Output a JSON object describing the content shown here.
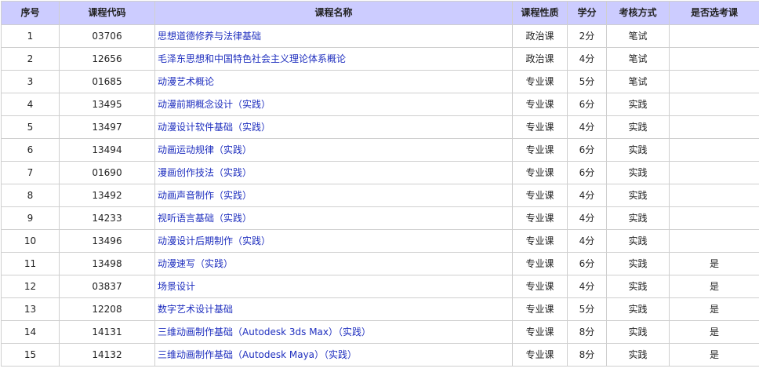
{
  "table": {
    "headers": [
      "序号",
      "课程代码",
      "课程名称",
      "课程性质",
      "学分",
      "考核方式",
      "是否选考课"
    ],
    "rows": [
      {
        "index": "1",
        "code": "03706",
        "name": "思想道德修养与法律基础",
        "type": "政治课",
        "credit": "2分",
        "exam": "笔试",
        "elective": ""
      },
      {
        "index": "2",
        "code": "12656",
        "name": "毛泽东思想和中国特色社会主义理论体系概论",
        "type": "政治课",
        "credit": "4分",
        "exam": "笔试",
        "elective": ""
      },
      {
        "index": "3",
        "code": "01685",
        "name": "动漫艺术概论",
        "type": "专业课",
        "credit": "5分",
        "exam": "笔试",
        "elective": ""
      },
      {
        "index": "4",
        "code": "13495",
        "name": "动漫前期概念设计（实践）",
        "type": "专业课",
        "credit": "6分",
        "exam": "实践",
        "elective": ""
      },
      {
        "index": "5",
        "code": "13497",
        "name": "动漫设计软件基础（实践）",
        "type": "专业课",
        "credit": "4分",
        "exam": "实践",
        "elective": ""
      },
      {
        "index": "6",
        "code": "13494",
        "name": "动画运动规律（实践）",
        "type": "专业课",
        "credit": "6分",
        "exam": "实践",
        "elective": ""
      },
      {
        "index": "7",
        "code": "01690",
        "name": "漫画创作技法（实践）",
        "type": "专业课",
        "credit": "6分",
        "exam": "实践",
        "elective": ""
      },
      {
        "index": "8",
        "code": "13492",
        "name": "动画声音制作（实践）",
        "type": "专业课",
        "credit": "4分",
        "exam": "实践",
        "elective": ""
      },
      {
        "index": "9",
        "code": "14233",
        "name": "视听语言基础（实践）",
        "type": "专业课",
        "credit": "4分",
        "exam": "实践",
        "elective": ""
      },
      {
        "index": "10",
        "code": "13496",
        "name": "动漫设计后期制作（实践）",
        "type": "专业课",
        "credit": "4分",
        "exam": "实践",
        "elective": ""
      },
      {
        "index": "11",
        "code": "13498",
        "name": "动漫速写（实践）",
        "type": "专业课",
        "credit": "6分",
        "exam": "实践",
        "elective": "是"
      },
      {
        "index": "12",
        "code": "03837",
        "name": "场景设计",
        "type": "专业课",
        "credit": "4分",
        "exam": "实践",
        "elective": "是"
      },
      {
        "index": "13",
        "code": "12208",
        "name": "数字艺术设计基础",
        "type": "专业课",
        "credit": "5分",
        "exam": "实践",
        "elective": "是"
      },
      {
        "index": "14",
        "code": "14131",
        "name": "三维动画制作基础（Autodesk 3ds Max）（实践）",
        "type": "专业课",
        "credit": "8分",
        "exam": "实践",
        "elective": "是"
      },
      {
        "index": "15",
        "code": "14132",
        "name": "三维动画制作基础（Autodesk Maya）（实践）",
        "type": "专业课",
        "credit": "8分",
        "exam": "实践",
        "elective": "是"
      }
    ]
  },
  "colors": {
    "header_bg": "#ccccff",
    "link": "#1f2fbf",
    "border": "#cfcfcf"
  }
}
